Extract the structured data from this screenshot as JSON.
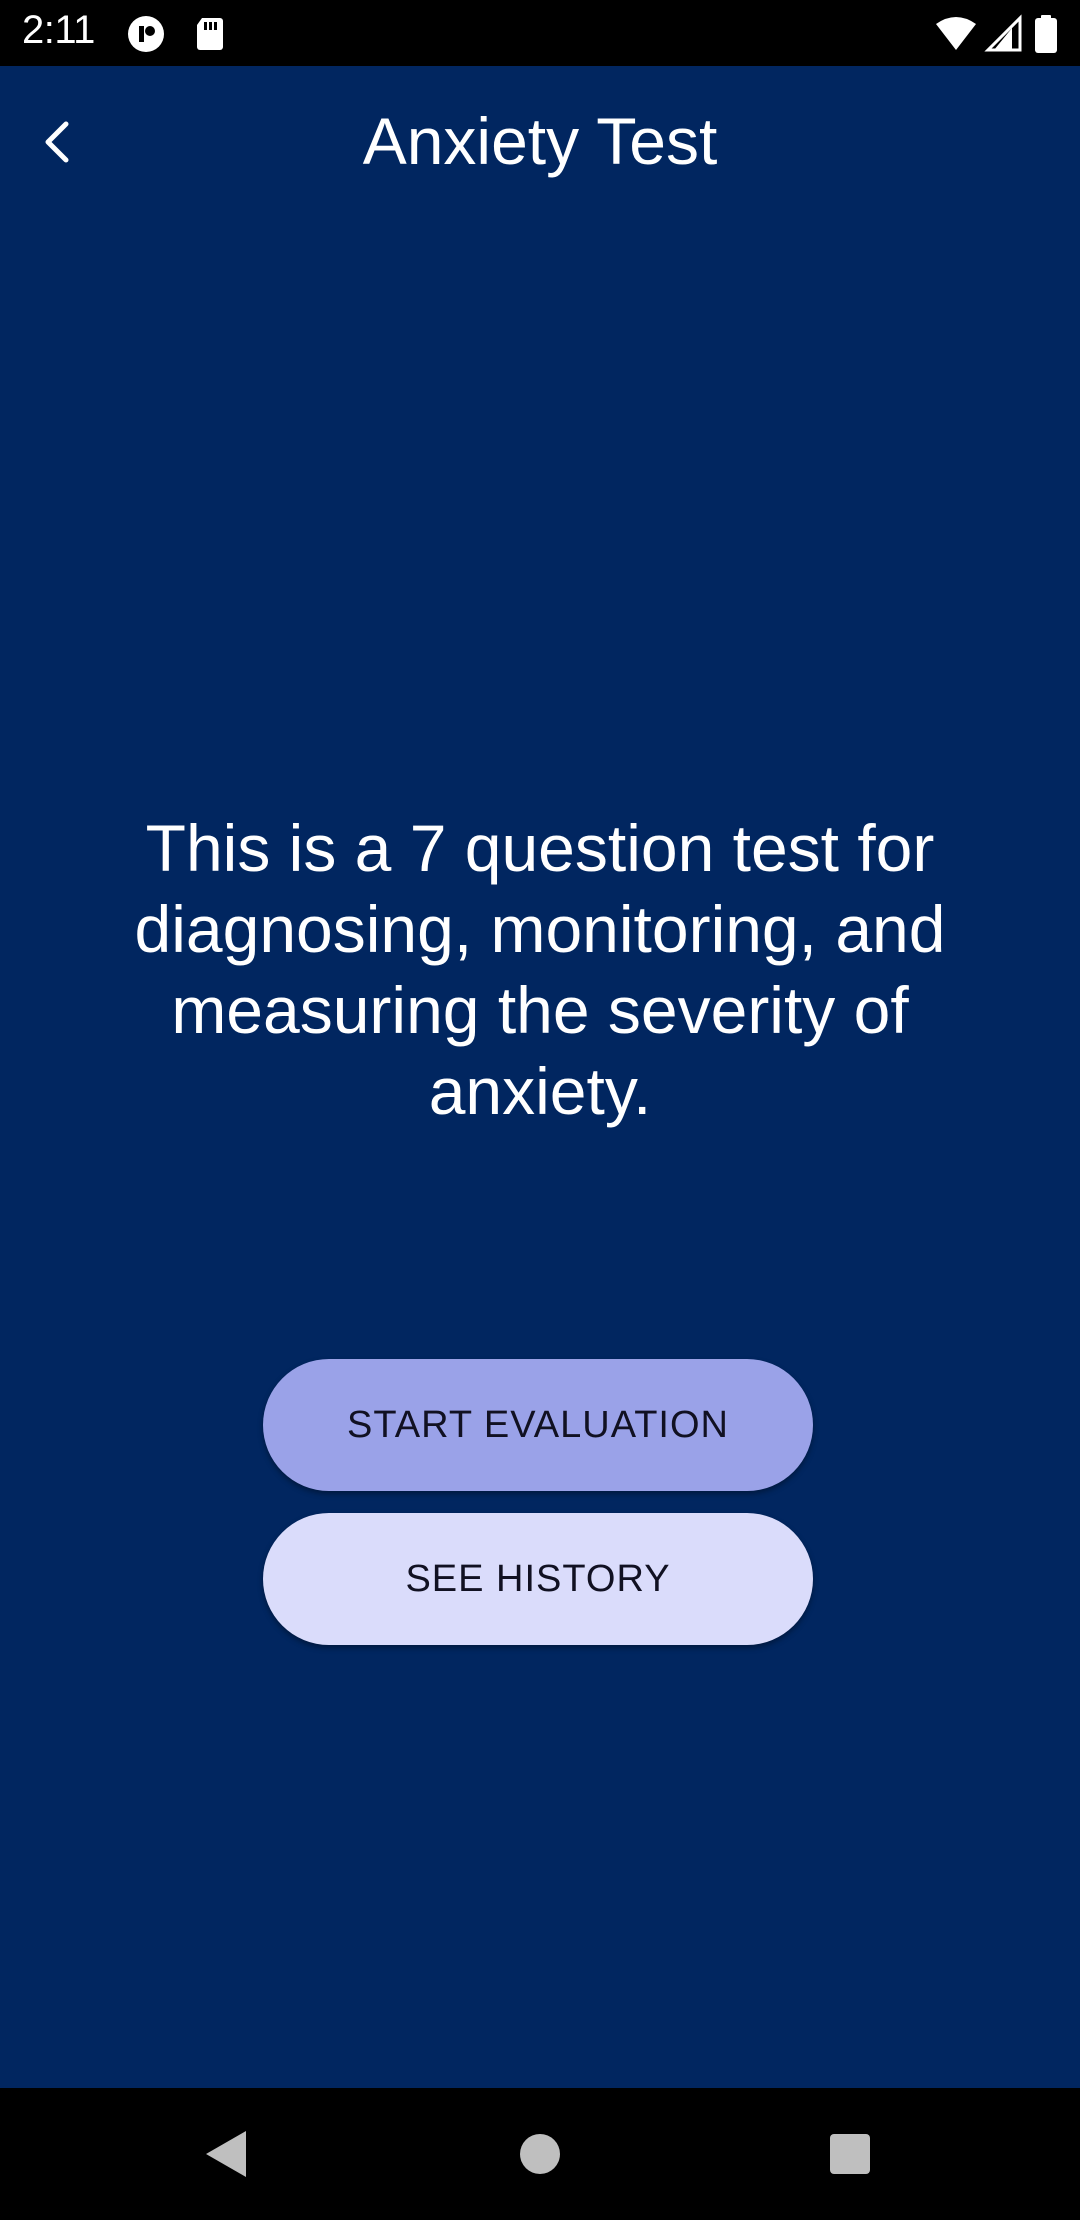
{
  "status_bar": {
    "time": "2:11",
    "icons": [
      "app-notification-icon",
      "sd-card-icon",
      "wifi-icon",
      "cell-signal-icon",
      "battery-icon"
    ]
  },
  "app_bar": {
    "title": "Anxiety Test",
    "back_icon": "back-arrow-icon"
  },
  "main": {
    "description": "This is a 7 question test for diagnosing, monitoring, and measuring the severity of anxiety.",
    "start_button_label": "START EVALUATION",
    "history_button_label": "SEE HISTORY"
  },
  "nav_bar": {
    "icons": [
      "back-triangle-icon",
      "home-circle-icon",
      "recents-square-icon"
    ]
  },
  "colors": {
    "background": "#012660",
    "start_button": "#9aa2e8",
    "history_button": "#dadcfb",
    "system_bars": "#000000"
  }
}
